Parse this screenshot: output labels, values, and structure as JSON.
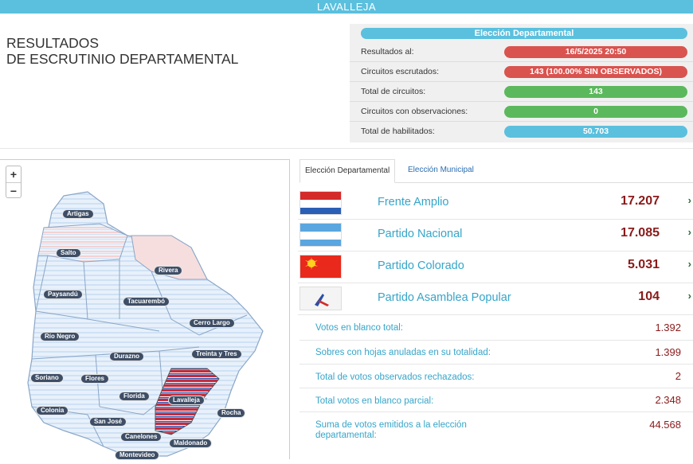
{
  "header": {
    "department": "LAVALLEJA"
  },
  "page": {
    "title_line1": "RESULTADOS",
    "title_line2": "DE ESCRUTINIO DEPARTAMENTAL"
  },
  "info": {
    "heading": "Elección Departamental",
    "rows": [
      {
        "label": "Resultados al:",
        "value": "16/5/2025 20:50",
        "color": "#d9534f"
      },
      {
        "label": "Circuitos escrutados:",
        "value": "143 (100.00% SIN OBSERVADOS)",
        "color": "#d9534f"
      },
      {
        "label": "Total de circuitos:",
        "value": "143",
        "color": "#5cb85c"
      },
      {
        "label": "Circuitos con observaciones:",
        "value": "0",
        "color": "#5cb85c"
      },
      {
        "label": "Total de habilitados:",
        "value": "50.703",
        "color": "#5bc0de"
      }
    ]
  },
  "map": {
    "zoom_in": "+",
    "zoom_out": "−",
    "departments": [
      "Artigas",
      "Salto",
      "Rivera",
      "Paysandú",
      "Tacuarembó",
      "Río Negro",
      "Cerro Largo",
      "Durazno",
      "Treinta y Tres",
      "Soriano",
      "Flores",
      "Florida",
      "Lavalleja",
      "Colonia",
      "San José",
      "Rocha",
      "Canelones",
      "Maldonado",
      "Montevideo"
    ]
  },
  "tabs": {
    "departmental": "Elección Departamental",
    "municipal": "Elección Municipal"
  },
  "parties": [
    {
      "name": "Frente Amplio",
      "votes": "17.207",
      "flag": "frente-amplio-flag"
    },
    {
      "name": "Partido Nacional",
      "votes": "17.085",
      "flag": "partido-nacional-flag"
    },
    {
      "name": "Partido Colorado",
      "votes": "5.031",
      "flag": "partido-colorado-flag"
    },
    {
      "name": "Partido Asamblea Popular",
      "votes": "104",
      "flag": "asamblea-popular-flag"
    }
  ],
  "chevron": "›",
  "summary": [
    {
      "label": "Votos en blanco total:",
      "value": "1.392"
    },
    {
      "label": "Sobres con hojas anuladas en su totalidad:",
      "value": "1.399"
    },
    {
      "label": "Total de votos observados rechazados:",
      "value": "2"
    },
    {
      "label": "Total votos en blanco parcial:",
      "value": "2.348"
    },
    {
      "label": "Suma de votos emitidos a la elección departamental:",
      "value": "44.568"
    }
  ],
  "colors": {
    "accent": "#5bc0de",
    "votes": "#8a1a1a",
    "party_name": "#36a5c9"
  }
}
